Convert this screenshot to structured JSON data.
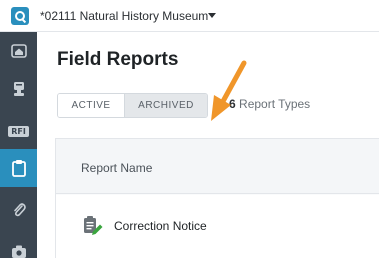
{
  "header": {
    "project_name": "*02111 Natural History Museum"
  },
  "sidebar": {
    "items": [
      {
        "name": "home",
        "icon": "home-icon"
      },
      {
        "name": "documents",
        "icon": "stamp-icon"
      },
      {
        "name": "rfi",
        "label": "RFI"
      },
      {
        "name": "field-reports",
        "icon": "clipboard-icon",
        "active": true
      },
      {
        "name": "attachments",
        "icon": "paperclip-icon"
      },
      {
        "name": "photos",
        "icon": "camera-icon"
      }
    ]
  },
  "main": {
    "title": "Field Reports",
    "tabs": [
      {
        "label": "ACTIVE",
        "selected": false
      },
      {
        "label": "ARCHIVED",
        "selected": true
      }
    ],
    "report_types_count": "6",
    "report_types_label": "Report Types",
    "table": {
      "column_header": "Report Name",
      "rows": [
        {
          "name": "Correction Notice",
          "icon": "clipboard-edit-icon"
        }
      ]
    }
  },
  "colors": {
    "accent": "#2a8fbd",
    "sidebar_bg": "#3a4550",
    "annotation_arrow": "#f0962a"
  }
}
